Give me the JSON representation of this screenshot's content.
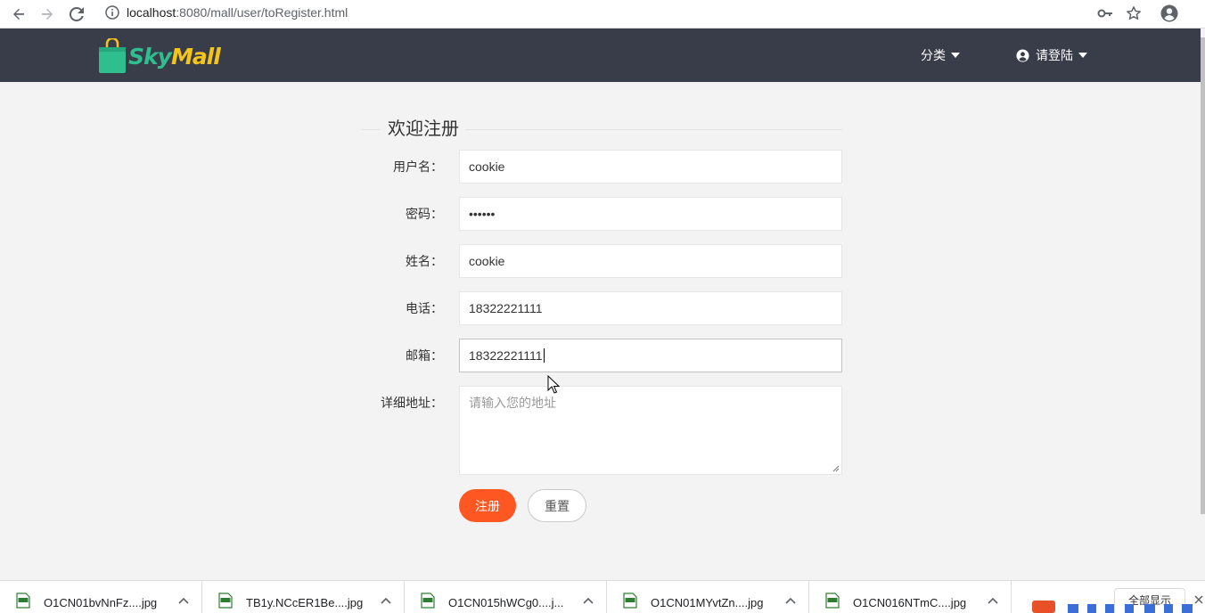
{
  "browser": {
    "url_host": "localhost",
    "url_path": ":8080/mall/user/toRegister.html"
  },
  "header": {
    "logo_text_1": "Sky",
    "logo_text_2": "Mall",
    "nav_category": "分类",
    "nav_login": "请登陆"
  },
  "form": {
    "legend": "欢迎注册",
    "fields": [
      {
        "label": "用户名：",
        "value": "cookie"
      },
      {
        "label": "密码：",
        "value": "••••••"
      },
      {
        "label": "姓名：",
        "value": "cookie"
      },
      {
        "label": "电话：",
        "value": "18322221111"
      },
      {
        "label": "邮箱：",
        "value": "18322221111"
      }
    ],
    "address_label": "详细地址：",
    "address_placeholder": "请输入您的地址",
    "submit_label": "注册",
    "reset_label": "重置"
  },
  "downloads": {
    "items": [
      {
        "name": "O1CN01bvNnFz....jpg"
      },
      {
        "name": "TB1y.NCcER1Be....jpg"
      },
      {
        "name": "O1CN015hWCg0....j..."
      },
      {
        "name": "O1CN01MYvtZn....jpg"
      },
      {
        "name": "O1CN016NTmC....jpg"
      }
    ],
    "show_all_label": "全部显示"
  },
  "colors": {
    "header_bg": "#393d49",
    "primary_button": "#ff5722",
    "page_bg": "#f3f3f3",
    "logo_green": "#2fbf8f",
    "logo_yellow": "#f5c518"
  }
}
